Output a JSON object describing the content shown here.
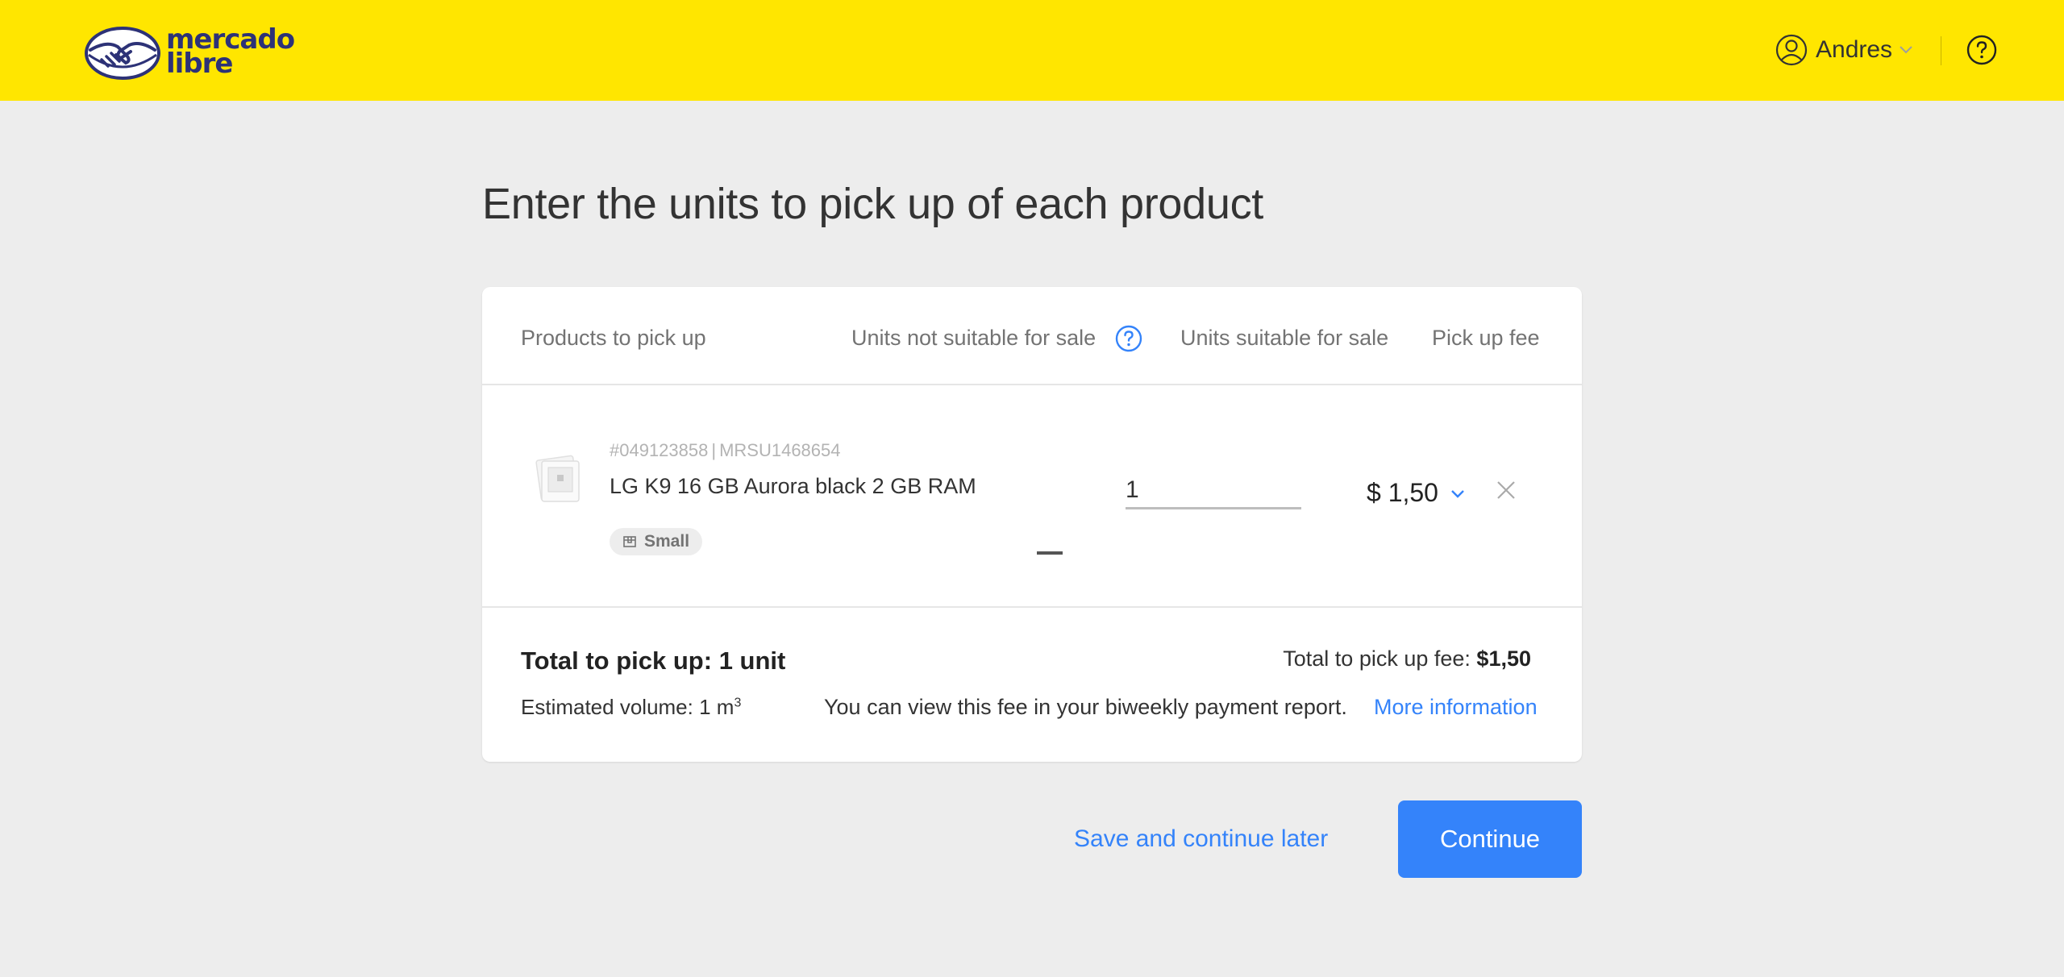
{
  "header": {
    "logo_text_line1": "mercado",
    "logo_text_line2": "libre",
    "user_name": "Andres",
    "icons": {
      "avatar": "user-circle-icon",
      "chevron": "chevron-down-icon",
      "help": "question-circle-icon"
    }
  },
  "page": {
    "title": "Enter the units to pick up of each product"
  },
  "table": {
    "columns": {
      "products": "Products to pick up",
      "unsuitable": "Units not suitable for sale",
      "suitable": "Units suitable for sale",
      "fee": "Pick up fee"
    },
    "rows": [
      {
        "sku_id": "#049123858",
        "sku_code": "MRSU1468654",
        "name": "LG K9 16 GB Aurora black 2 GB RAM",
        "size": "Small",
        "units_not_suitable": "—",
        "units_suitable": "1",
        "fee": "$ 1,50"
      }
    ]
  },
  "summary": {
    "total_label": "Total to pick up:",
    "total_value": "1 unit",
    "volume_label": "Estimated volume: 1 m",
    "volume_exp": "3",
    "fee_label": "Total to pick up fee:",
    "fee_value": "$1,50",
    "fee_note": "You can view this fee in your biweekly payment report.",
    "more_info": "More information"
  },
  "actions": {
    "save_later": "Save and continue later",
    "continue": "Continue"
  },
  "colors": {
    "header_bg": "#ffe600",
    "page_bg": "#ededed",
    "accent": "#3483fa",
    "logo_navy": "#2d3277"
  }
}
